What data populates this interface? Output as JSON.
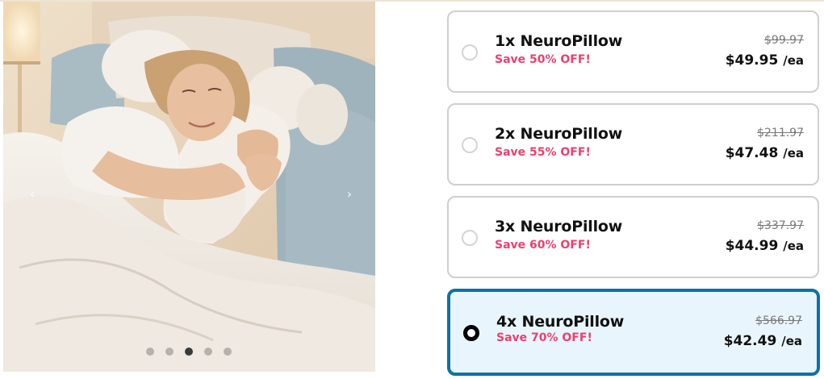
{
  "gallery": {
    "image_alt": "Woman sleeping while hugging a white NeuroPillow",
    "prev_icon": "chevron-left-icon",
    "next_icon": "chevron-right-icon",
    "prev_glyph": "‹",
    "next_glyph": "›",
    "slide_count": 5,
    "active_slide": 3
  },
  "bundles": [
    {
      "title": "1x NeuroPillow",
      "save": "Save 50% OFF!",
      "old_price": "$99.97",
      "price": "$49.95",
      "unit": "/ea",
      "selected": false
    },
    {
      "title": "2x NeuroPillow",
      "save": "Save 55% OFF!",
      "old_price": "$211.97",
      "price": "$47.48",
      "unit": "/ea",
      "selected": false
    },
    {
      "title": "3x NeuroPillow",
      "save": "Save 60% OFF!",
      "old_price": "$337.97",
      "price": "$44.99",
      "unit": "/ea",
      "selected": false
    },
    {
      "title": "4x NeuroPillow",
      "save": "Save 70% OFF!",
      "old_price": "$566.97",
      "price": "$42.49",
      "unit": "/ea",
      "selected": true
    }
  ],
  "colors": {
    "accent": "#0b72a8",
    "selected_bg": "#e9f5fd",
    "save_text": "#ee3f6d",
    "border": "#cfcfcf"
  }
}
